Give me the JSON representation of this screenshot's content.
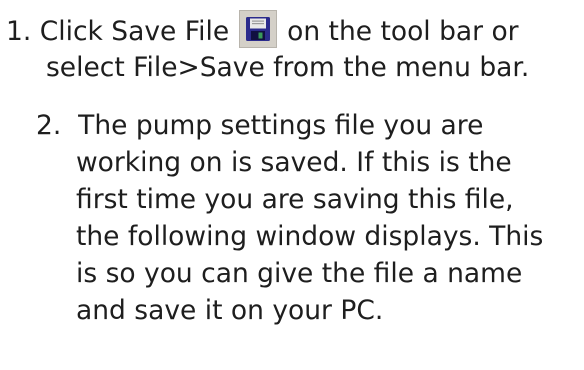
{
  "step1": {
    "number": "1.",
    "text_before_icon": "Click Save File",
    "icon": "save-floppy-icon",
    "text_after_icon": "on the tool bar or",
    "line2": "select File>Save from the menu bar."
  },
  "step2": {
    "number": "2.",
    "lines": [
      "The pump settings file you are",
      "working on is saved. If this is the",
      "first time you are saving this file,",
      "the following window displays. This",
      "is so you can give the file a name",
      "and save it on your PC."
    ]
  },
  "colors": {
    "text": "#1e1e1e",
    "icon_background": "#d4d0c8",
    "floppy_body": "#2b2b8c",
    "floppy_label": "#e8e8e8",
    "floppy_shutter": "#3a9a5a"
  }
}
